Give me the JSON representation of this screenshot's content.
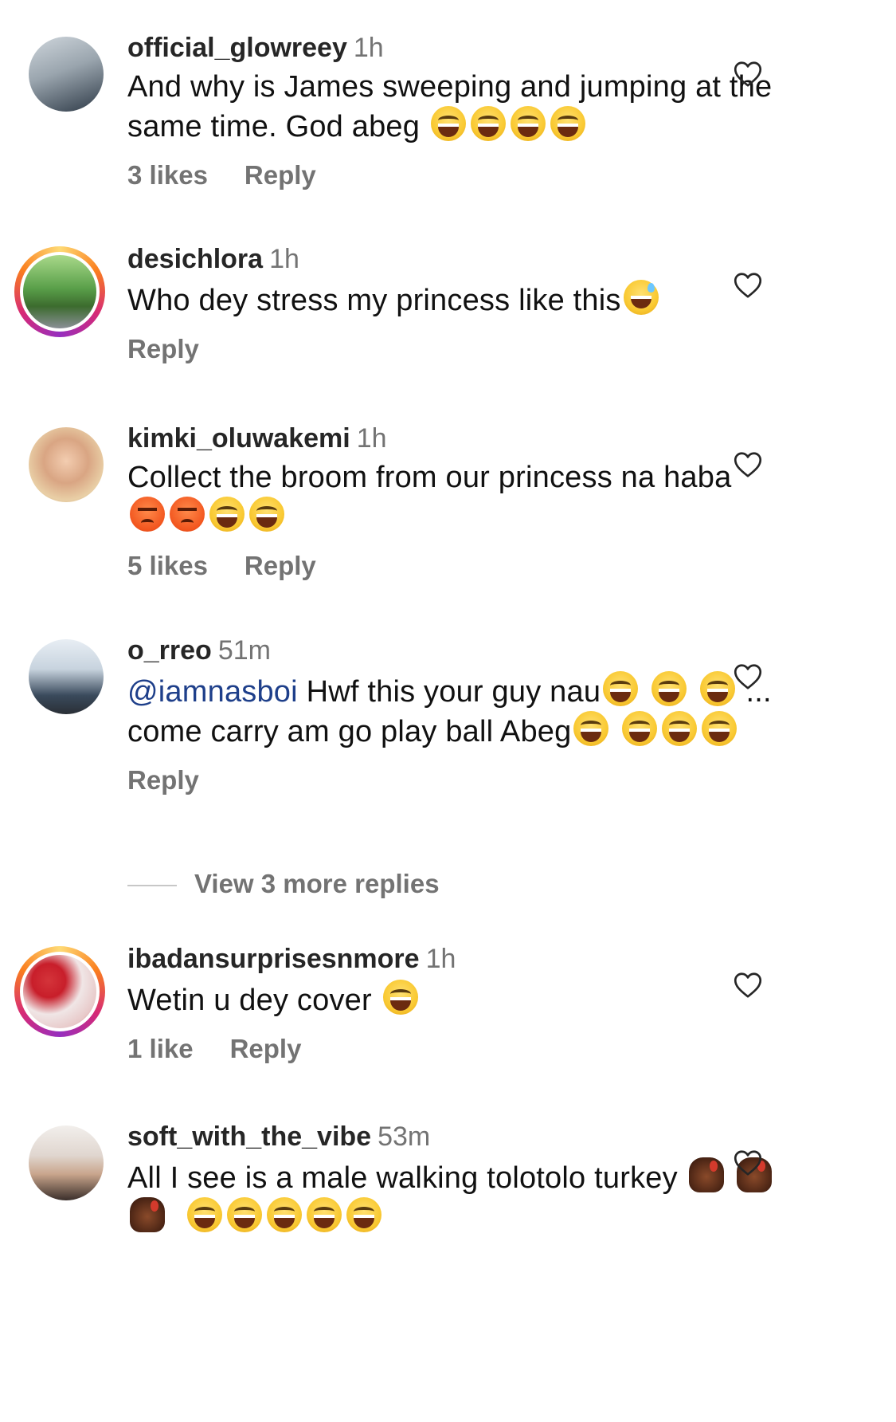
{
  "comments": [
    {
      "username": "official_glowreey",
      "time": "1h",
      "text": "And why is James sweeping and jumping at the same time. God abeg",
      "emojis": [
        "laugh",
        "laugh",
        "laugh",
        "laugh"
      ],
      "likes": "3 likes",
      "reply": "Reply",
      "ring": false
    },
    {
      "username": "desichlora",
      "time": "1h",
      "text": "Who dey stress my princess like this",
      "emojis": [
        "sweat"
      ],
      "likes": "",
      "reply": "Reply",
      "ring": true
    },
    {
      "username": "kimki_oluwakemi",
      "time": "1h",
      "text": "Collect the broom from our princess na haba",
      "emojis": [
        "angry",
        "angry",
        "laugh",
        "laugh"
      ],
      "likes": "5 likes",
      "reply": "Reply",
      "ring": false
    },
    {
      "username": "o_rreo",
      "time": "51m",
      "mention": "@iamnasboi",
      "text": "Hwf this your guy nau",
      "text2": "... come carry am go play ball Abeg",
      "likes": "",
      "reply": "Reply",
      "ring": false
    },
    {
      "username": "ibadansurprisesnmore",
      "time": "1h",
      "text": "Wetin u dey cover",
      "emojis": [
        "laugh"
      ],
      "likes": "1 like",
      "reply": "Reply",
      "ring": true
    },
    {
      "username": "soft_with_the_vibe",
      "time": "53m",
      "text": "All I see is a male walking tolotolo turkey",
      "emojis": [
        "turkey",
        "turkey",
        "turkey",
        "laugh",
        "laugh",
        "laugh",
        "laugh",
        "laugh"
      ],
      "likes": "",
      "reply": "",
      "ring": false
    }
  ],
  "view_more_replies": "View 3 more replies",
  "icons": {
    "like": "heart-outline-icon"
  },
  "colors": {
    "mention": "#1e3f8a",
    "secondary": "#737373"
  }
}
